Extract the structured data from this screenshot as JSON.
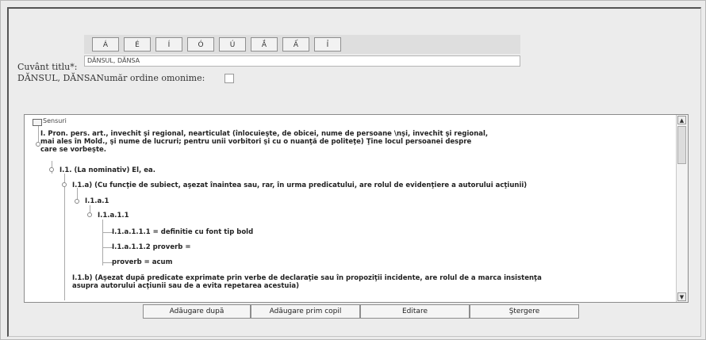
{
  "diacritics": [
    "Á",
    "É",
    "Í",
    "Ó",
    "Ú",
    "Ắ",
    "Ấ",
    "Ỉ"
  ],
  "form": {
    "title_label": "Cuvânt titlu*:",
    "title_value": "DĂNSUL, DĂNSA",
    "title_echo": "DĂNSUL, DĂNSA",
    "homonym_label": "Număr ordine omonime:"
  },
  "tree": {
    "root_label": "Sensuri",
    "nodes": [
      {
        "lines": [
          "I. Pron. pers. art., invechit şi regional, nearticulat (înlocuieşte, de obicei, nume de persoane \\nşi, invechit şi regional,",
          "mai ales în Mold., şi nume de lucruri; pentru unii vorbitori şi cu o nuanţă de politeţe) Ţine locul persoanei despre",
          "care se vorbeşte."
        ]
      },
      {
        "lines": [
          "I.1. (La nominativ) El, ea."
        ]
      },
      {
        "lines": [
          "I.1.a) (Cu funcţie de subiect, aşezat înaintea sau, rar, în urma predicatului, are rolul de evidenţiere a autorului acţiunii)"
        ]
      },
      {
        "lines": [
          "I.1.a.1"
        ]
      },
      {
        "lines": [
          "I.1.a.1.1"
        ]
      },
      {
        "lines": [
          "I.1.a.1.1.1 = definitie cu font tip bold"
        ]
      },
      {
        "lines": [
          "I.1.a.1.1.2 proverb ="
        ]
      },
      {
        "lines": [
          "proverb = acum"
        ]
      },
      {
        "lines": [
          "I.1.b) (Aşezat după predicate exprimate prin verbe de declaraţie sau în propoziţii incidente, are rolul de a marca insistenţa",
          "asupra autorului acţiunii sau de a evita repetarea acestuia)"
        ]
      }
    ]
  },
  "actions": [
    "Adăugare după",
    "Adăugare prim copil",
    "Editare",
    "Ştergere"
  ]
}
